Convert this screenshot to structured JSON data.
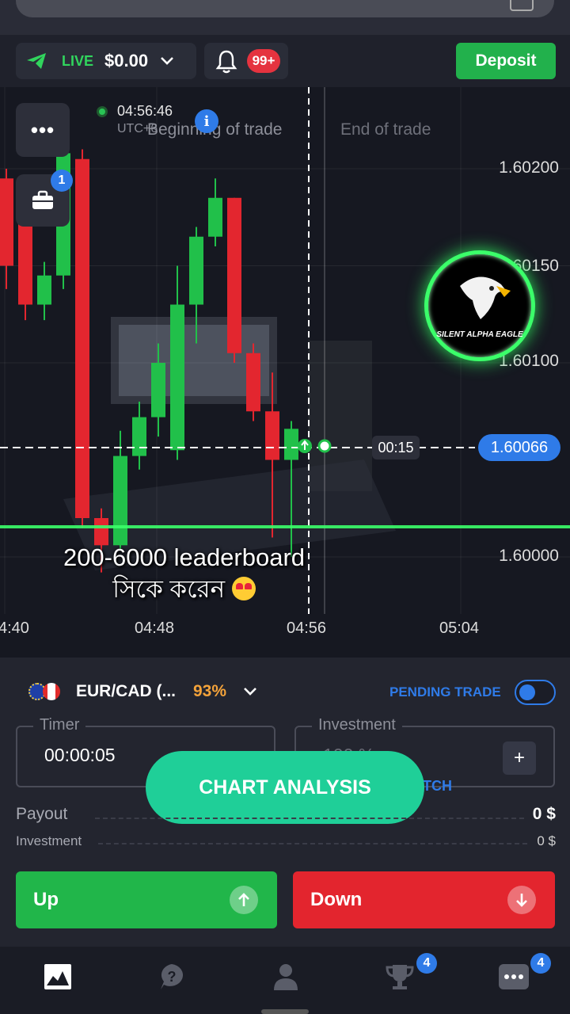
{
  "header": {
    "live_label": "LIVE",
    "balance": "$0.00",
    "notifications": "99+",
    "deposit_label": "Deposit"
  },
  "chart": {
    "clock_time": "04:56:46",
    "clock_tz": "UTC+6",
    "beginning_label": "Beginning of trade",
    "end_label": "End of trade",
    "portfolio_badge": "1",
    "price_ticks": [
      "1.60200",
      "1.60150",
      "1.60100",
      "1.60000"
    ],
    "current_price": "1.60066",
    "countdown": "00:15",
    "time_ticks": [
      "4:40",
      "04:48",
      "04:56",
      "05:04"
    ],
    "logo_text": "SILENT ALPHA EAGLE",
    "caption_line1": "200-6000 leaderboard",
    "caption_line2": "সিকে করেন"
  },
  "chart_data": {
    "type": "candlestick",
    "candles": [
      {
        "o": 1.60195,
        "c": 1.6015,
        "h": 1.602,
        "l": 1.60138
      },
      {
        "o": 1.60185,
        "c": 1.6013,
        "h": 1.60192,
        "l": 1.60122
      },
      {
        "o": 1.6013,
        "c": 1.60145,
        "h": 1.60152,
        "l": 1.60122
      },
      {
        "o": 1.60145,
        "c": 1.60208,
        "h": 1.60212,
        "l": 1.60138
      },
      {
        "o": 1.60205,
        "c": 1.6002,
        "h": 1.6021,
        "l": 1.60015
      },
      {
        "o": 1.6002,
        "c": 1.60006,
        "h": 1.60025,
        "l": 1.59992
      },
      {
        "o": 1.60006,
        "c": 1.60052,
        "h": 1.60065,
        "l": 1.60004
      },
      {
        "o": 1.60052,
        "c": 1.60072,
        "h": 1.6008,
        "l": 1.60045
      },
      {
        "o": 1.60072,
        "c": 1.601,
        "h": 1.6011,
        "l": 1.60062
      },
      {
        "o": 1.60055,
        "c": 1.6013,
        "h": 1.6015,
        "l": 1.6005
      },
      {
        "o": 1.6013,
        "c": 1.60165,
        "h": 1.6017,
        "l": 1.6011
      },
      {
        "o": 1.60165,
        "c": 1.60185,
        "h": 1.60195,
        "l": 1.6016
      },
      {
        "o": 1.60185,
        "c": 1.60105,
        "h": 1.60185,
        "l": 1.601
      },
      {
        "o": 1.60105,
        "c": 1.60075,
        "h": 1.6011,
        "l": 1.6007
      },
      {
        "o": 1.60075,
        "c": 1.6005,
        "h": 1.60095,
        "l": 1.6001
      },
      {
        "o": 1.6005,
        "c": 1.60066,
        "h": 1.6007,
        "l": 1.6
      }
    ],
    "y_ticks": [
      1.602,
      1.6015,
      1.601,
      1.6
    ],
    "x_ticks": [
      "4:40",
      "04:48",
      "04:56",
      "05:04"
    ],
    "current_price": 1.60066,
    "colors": {
      "up": "#21c04a",
      "down": "#e3262f"
    }
  },
  "trade": {
    "pair": "EUR/CAD (...",
    "payout_pct": "93%",
    "pending_label": "PENDING TRADE",
    "timer_label": "Timer",
    "timer_value": "00:00:05",
    "investment_label": "Investment",
    "investment_value": "100 %",
    "switch_label": "TCH",
    "analysis_label": "CHART ANALYSIS",
    "payout_label": "Payout",
    "payout_value": "0 $",
    "investment_row_label": "Investment",
    "investment_row_value": "0 $",
    "up_label": "Up",
    "down_label": "Down"
  },
  "nav": {
    "tournament_badge": "4",
    "more_badge": "4"
  },
  "colors": {
    "accent_blue": "#2f7be8",
    "green": "#21b64a",
    "red": "#e3252e",
    "teal": "#1fcf98",
    "orange": "#f4a33a"
  }
}
